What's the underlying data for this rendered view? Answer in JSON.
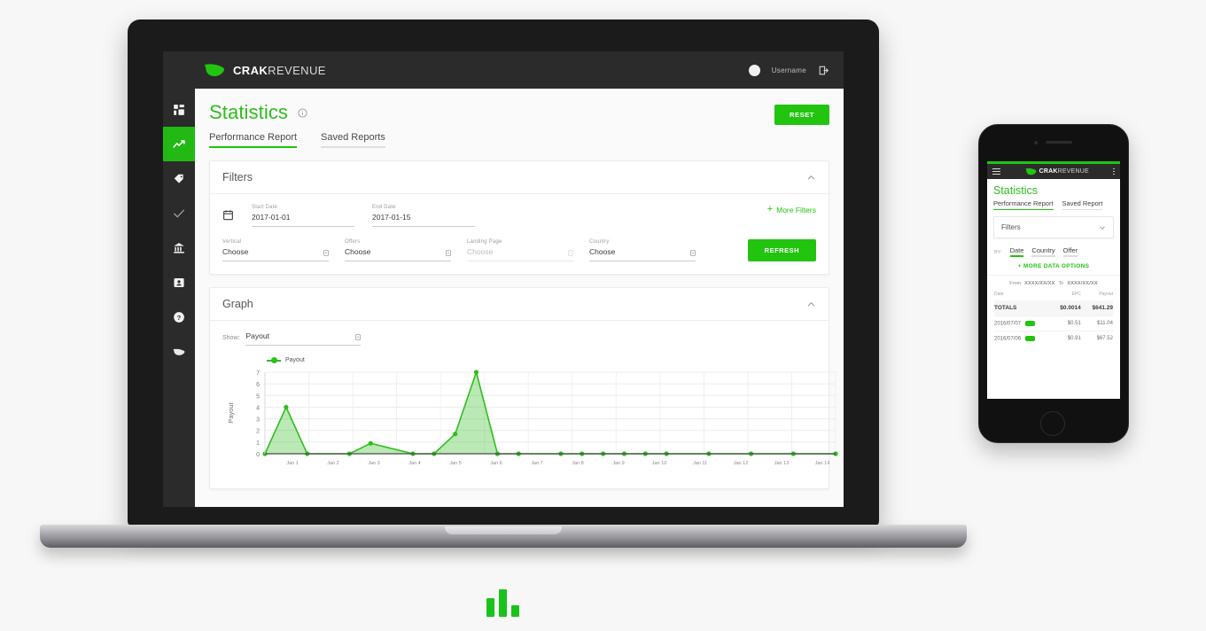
{
  "brand": {
    "bold": "CRAK",
    "light": "REVENUE"
  },
  "topbar": {
    "username": "Username",
    "logout_icon": "logout-icon",
    "avatar_icon": "avatar"
  },
  "sidebar": {
    "items": [
      {
        "name": "dashboard",
        "icon": "grid-icon",
        "active": false
      },
      {
        "name": "statistics",
        "icon": "chart-line-icon",
        "active": true
      },
      {
        "name": "offers",
        "icon": "tag-icon",
        "active": false
      },
      {
        "name": "approvals",
        "icon": "check-icon",
        "active": false
      },
      {
        "name": "billing",
        "icon": "bank-icon",
        "active": false
      },
      {
        "name": "account",
        "icon": "contact-card-icon",
        "active": false
      },
      {
        "name": "help",
        "icon": "question-circle-icon",
        "active": false
      },
      {
        "name": "crak-logo",
        "icon": "bird-logo-icon",
        "active": false
      }
    ]
  },
  "page": {
    "title": "Statistics",
    "info_icon": "info-icon",
    "reset_label": "RESET",
    "tabs": [
      {
        "label": "Performance Report",
        "active": true
      },
      {
        "label": "Saved Reports",
        "active": false
      }
    ]
  },
  "filters": {
    "title": "Filters",
    "collapse_icon": "chevron-up-icon",
    "calendar_icon": "calendar-icon",
    "more_filters": "More Filters",
    "more_filters_plus": "+",
    "refresh_label": "REFRESH",
    "start_date": {
      "label": "Start Date",
      "value": "2017-01-01"
    },
    "end_date": {
      "label": "End Date",
      "value": "2017-01-15"
    },
    "vertical": {
      "label": "Vertical",
      "value": "Choose",
      "placeholder": false
    },
    "offers": {
      "label": "Offers",
      "value": "Choose",
      "placeholder": false
    },
    "landing": {
      "label": "Landing Page",
      "value": "Choose",
      "placeholder": true
    },
    "country": {
      "label": "Country",
      "value": "Choose",
      "placeholder": false
    }
  },
  "graph": {
    "title": "Graph",
    "collapse_icon": "chevron-up-icon",
    "show_label": "Show:",
    "show_value": "Payout",
    "legend": "Payout"
  },
  "chart_data": {
    "type": "area",
    "title": "",
    "xlabel": "",
    "ylabel": "Payout",
    "ylim": [
      0,
      7
    ],
    "yticks": [
      0,
      1,
      2,
      3,
      4,
      5,
      6,
      7
    ],
    "grid": true,
    "legend": [
      "Payout"
    ],
    "legend_position": "top-left",
    "color": "#2fbd1f",
    "categories": [
      "Jan 1",
      "Jan 2",
      "Jan 3",
      "Jan 4",
      "Jan 5",
      "Jan 6",
      "Jan 7",
      "Jan 8",
      "Jan 9",
      "Jan 10",
      "Jan 11",
      "Jan 12",
      "Jan 13",
      "Jan 14"
    ],
    "x": [
      0,
      0.5,
      1,
      1.5,
      2,
      2.5,
      3,
      3.5,
      4,
      4.5,
      5,
      5.5,
      6,
      6.5,
      7,
      7.5,
      8,
      8.5,
      9,
      9.5,
      10,
      10.5,
      11,
      11.5,
      12,
      12.5,
      13,
      13.5
    ],
    "series": [
      {
        "name": "Payout",
        "values": [
          0,
          4,
          0,
          0,
          0,
          0.9,
          0,
          0,
          1.7,
          7,
          0,
          0,
          0,
          0,
          0,
          0,
          0,
          0,
          0,
          0,
          0,
          0,
          0,
          0,
          0,
          0,
          0,
          0
        ]
      }
    ],
    "points_x": [
      0,
      0.5,
      1,
      2,
      2.5,
      3.5,
      4,
      4.5,
      5,
      5.5,
      6,
      7,
      7.5,
      8,
      8.5,
      9,
      9.5,
      10.5,
      11.5,
      12.5,
      13.5
    ],
    "points_y": [
      0,
      4,
      0,
      0,
      0.9,
      0,
      0,
      1.7,
      7,
      0,
      0,
      0,
      0,
      0,
      0,
      0,
      0,
      0,
      0,
      0,
      0
    ]
  },
  "mobile": {
    "brand": {
      "bold": "CRAK",
      "light": "REVENUE"
    },
    "menu_icon": "hamburger-icon",
    "kebab_icon": "kebab-menu-icon",
    "title": "Statistics",
    "tabs": [
      {
        "label": "Performance Report",
        "active": true
      },
      {
        "label": "Saved Report",
        "active": false
      }
    ],
    "filters_label": "Filters",
    "filters_chevron": "chevron-down-icon",
    "by_label": "BY:",
    "by_options": [
      {
        "label": "Date",
        "active": true
      },
      {
        "label": "Country",
        "active": false
      },
      {
        "label": "Offer",
        "active": false
      }
    ],
    "more_data_options": "+ MORE DATA OPTIONS",
    "range": {
      "from_label": "From",
      "from_value": "XXXX/XX/XX",
      "to_label": "To",
      "to_value": "XXXX/XX/XX"
    },
    "table": {
      "headers": [
        "Date",
        "EPC",
        "Payout"
      ],
      "totals": {
        "label": "TOTALS",
        "epc": "$0.0014",
        "payout": "$641.29"
      },
      "rows": [
        {
          "date": "2016/07/07",
          "epc": "$0.51",
          "payout": "$11.04"
        },
        {
          "date": "2016/07/06",
          "epc": "$0.91",
          "payout": "$67.52"
        }
      ]
    }
  },
  "footer": {
    "logo_icon": "bar-chart-logo"
  },
  "colors": {
    "brand_green": "#22c40f",
    "title_green": "#2fbd1f",
    "dark": "#2b2b2b"
  }
}
